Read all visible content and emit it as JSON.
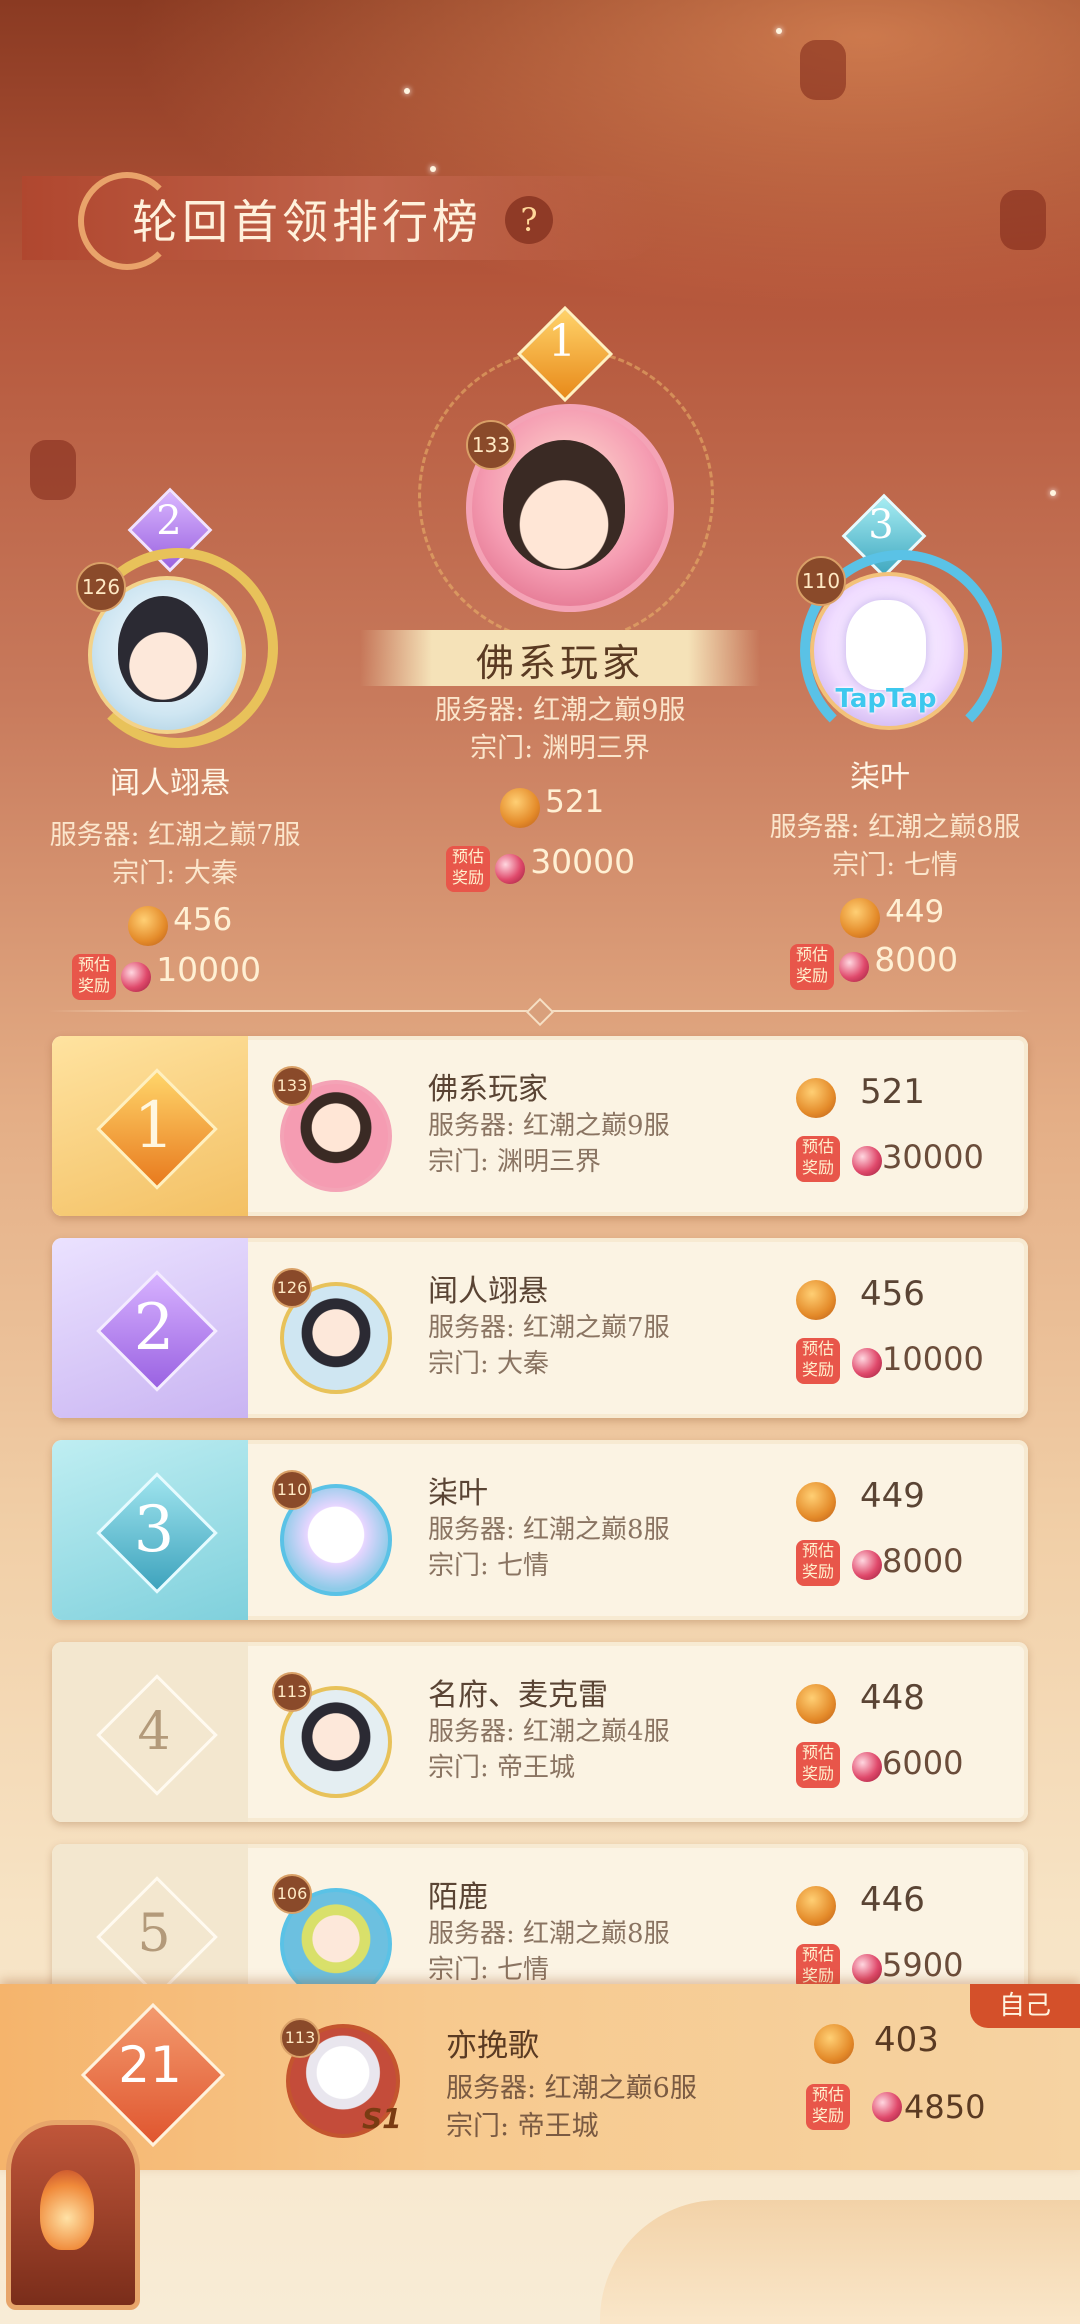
{
  "header": {
    "title": "轮回首领排行榜",
    "help": "?"
  },
  "podium": [
    {
      "rank": "1",
      "level": "133",
      "name": "佛系玩家",
      "server": "服务器: 红潮之巅9服",
      "sect": "宗门: 渊明三界",
      "score": "521",
      "reward_tag": "预估奖励",
      "reward": "30000"
    },
    {
      "rank": "2",
      "level": "126",
      "name": "闻人翊悬",
      "server": "服务器: 红潮之巅7服",
      "sect": "宗门: 大秦",
      "score": "456",
      "reward_tag": "预估奖励",
      "reward": "10000"
    },
    {
      "rank": "3",
      "level": "110",
      "name": "柒叶",
      "server": "服务器: 红潮之巅8服",
      "sect": "宗门: 七情",
      "score": "449",
      "reward_tag": "预估奖励",
      "reward": "8000",
      "avatar_badge": "TapTap"
    }
  ],
  "rows": [
    {
      "rank": "1",
      "level": "133",
      "name": "佛系玩家",
      "server": "服务器: 红潮之巅9服",
      "sect": "宗门: 渊明三界",
      "score": "521",
      "reward_tag": "预估奖励",
      "reward": "30000"
    },
    {
      "rank": "2",
      "level": "126",
      "name": "闻人翊悬",
      "server": "服务器: 红潮之巅7服",
      "sect": "宗门: 大秦",
      "score": "456",
      "reward_tag": "预估奖励",
      "reward": "10000"
    },
    {
      "rank": "3",
      "level": "110",
      "name": "柒叶",
      "server": "服务器: 红潮之巅8服",
      "sect": "宗门: 七情",
      "score": "449",
      "reward_tag": "预估奖励",
      "reward": "8000"
    },
    {
      "rank": "4",
      "level": "113",
      "name": "名府、麦克雷",
      "server": "服务器: 红潮之巅4服",
      "sect": "宗门: 帝王城",
      "score": "448",
      "reward_tag": "预估奖励",
      "reward": "6000"
    },
    {
      "rank": "5",
      "level": "106",
      "name": "陌鹿",
      "server": "服务器: 红潮之巅8服",
      "sect": "宗门: 七情",
      "score": "446",
      "reward_tag": "预估奖励",
      "reward": "5900"
    }
  ],
  "self": {
    "tag": "自己",
    "rank": "21",
    "level": "113",
    "badge": "S1",
    "name": "亦挽歌",
    "server": "服务器: 红潮之巅6服",
    "sect": "宗门: 帝王城",
    "score": "403",
    "reward_tag": "预估奖励",
    "reward": "4850"
  },
  "colors": {
    "gold": "#f0b24a",
    "purple": "#b98ce8",
    "teal": "#6cc7d4",
    "neutral": "#f1e2c8",
    "self": "#f4a460"
  }
}
